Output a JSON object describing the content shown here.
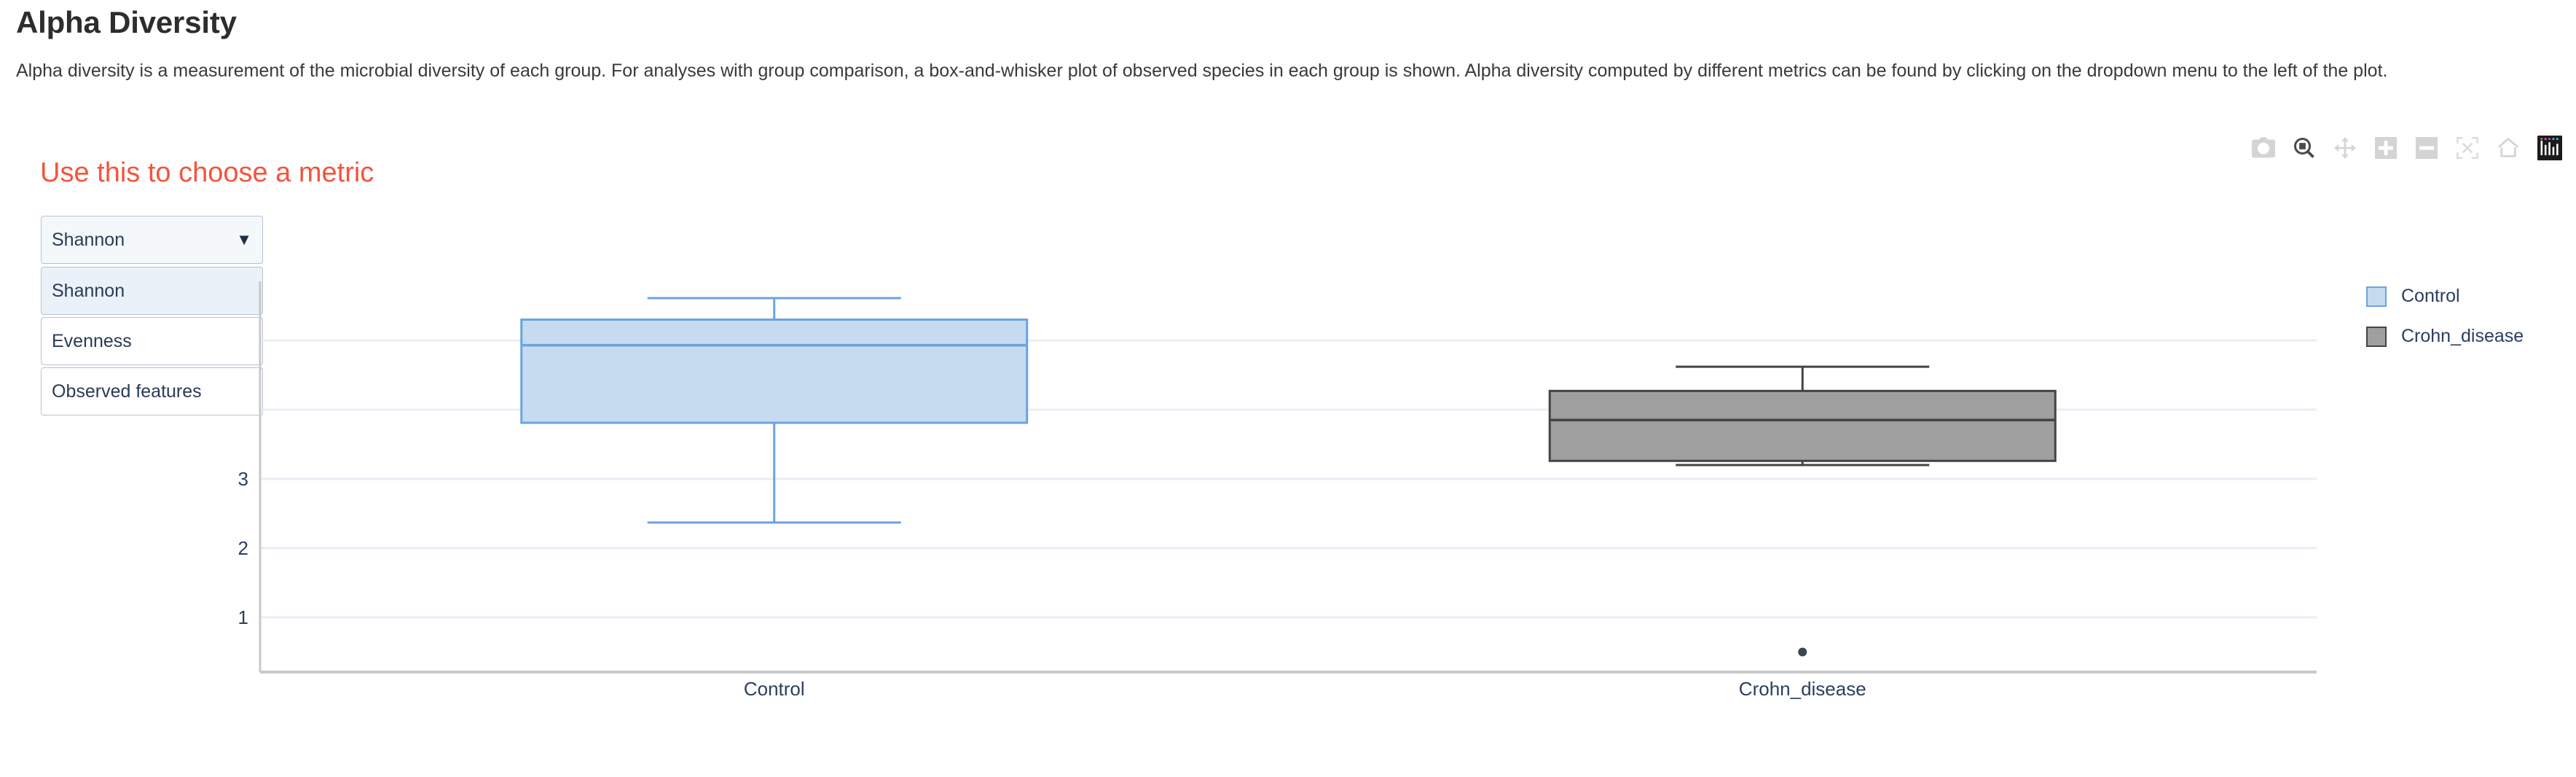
{
  "page": {
    "title": "Alpha Diversity",
    "description": "Alpha diversity is a measurement of the microbial diversity of each group. For analyses with group comparison, a box-and-whisker plot of observed species in each group is shown. Alpha diversity computed by different metrics can be found by clicking on the dropdown menu to the left of the plot."
  },
  "annotation": {
    "text": "Use this to choose a metric",
    "color": "#f4543c"
  },
  "metric_select": {
    "name": "alpha-diversity-metric",
    "value": "Shannon",
    "caret_icon": "chevron-down-icon",
    "expanded": true,
    "options": [
      "Shannon",
      "Evenness",
      "Observed features"
    ]
  },
  "modebar": {
    "buttons": [
      {
        "name": "camera-icon",
        "title": "Download plot as a png"
      },
      {
        "name": "zoom-magnifier-icon",
        "title": "Zoom"
      },
      {
        "name": "pan-arrows-icon",
        "title": "Pan"
      },
      {
        "name": "zoom-in-icon",
        "title": "Zoom in"
      },
      {
        "name": "zoom-out-icon",
        "title": "Zoom out"
      },
      {
        "name": "autoscale-icon",
        "title": "Autoscale"
      },
      {
        "name": "home-reset-icon",
        "title": "Reset axes"
      },
      {
        "name": "plotly-logo-icon",
        "title": "Produced with Plotly"
      }
    ]
  },
  "chart_data": {
    "type": "box",
    "title": "",
    "xlabel": "",
    "ylabel": "",
    "categories": [
      "Control",
      "Crohn_disease"
    ],
    "ytick_labels": [
      "1",
      "2",
      "3"
    ],
    "ytick_values": [
      1,
      2,
      3
    ],
    "hidden_gridline_values": [
      4,
      5
    ],
    "ylim": [
      0.2,
      5.9
    ],
    "grid": true,
    "legend_position": "right",
    "series": [
      {
        "name": "Control",
        "fill_color": "#c6dbf0",
        "line_color": "#6ba3e0",
        "whisker_high": 5.61,
        "q3": 5.3,
        "median": 4.93,
        "q1": 3.81,
        "whisker_low": 2.37,
        "outliers": []
      },
      {
        "name": "Crohn_disease",
        "fill_color": "#9f9f9f",
        "line_color": "#444444",
        "whisker_high": 4.62,
        "q3": 4.27,
        "median": 3.85,
        "q1": 3.26,
        "whisker_low": 3.2,
        "outliers": [
          0.5
        ]
      }
    ]
  }
}
